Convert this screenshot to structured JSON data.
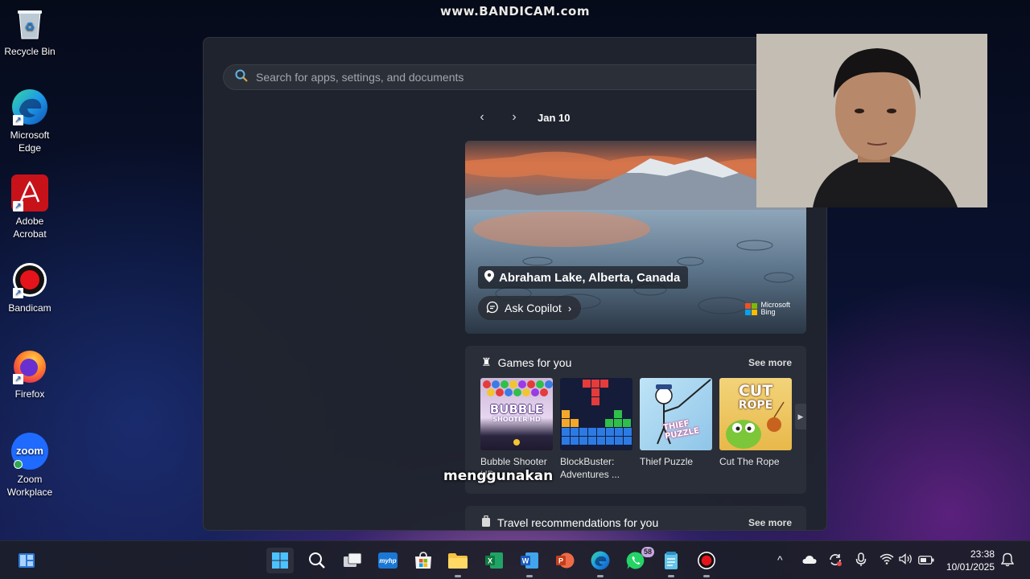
{
  "watermark": "www.BANDICAM.com",
  "desktop_icons": [
    {
      "label": "Recycle Bin"
    },
    {
      "label": "Microsoft Edge"
    },
    {
      "label": "Adobe Acrobat"
    },
    {
      "label": "Bandicam"
    },
    {
      "label": "Firefox"
    },
    {
      "label": "Zoom Workplace",
      "icon_text": "zoom"
    }
  ],
  "search": {
    "placeholder": "Search for apps, settings, and documents"
  },
  "date_nav": {
    "date": "Jan 10"
  },
  "hero": {
    "location": "Abraham Lake, Alberta, Canada",
    "ask_copilot": "Ask Copilot",
    "brand_line1": "Microsoft",
    "brand_line2": "Bing"
  },
  "games_card": {
    "title": "Games for you",
    "see_more": "See more",
    "games": [
      {
        "name": "Bubble Shooter HD",
        "thumb_text_1": "BUBBLE",
        "thumb_text_2": "SHOOTER HD"
      },
      {
        "name": "BlockBuster: Adventures ..."
      },
      {
        "name": "Thief Puzzle",
        "thumb_text": "THIEF PUZZLE"
      },
      {
        "name": "Cut The Rope",
        "thumb_text_1": "CUT",
        "thumb_text_2": "ROPE"
      }
    ]
  },
  "travel_card": {
    "title": "Travel recommendations for you",
    "see_more": "See more"
  },
  "caption": "menggunakan",
  "taskbar": {
    "whatsapp_badge": "58",
    "hp_label": "myhp",
    "time": "23:38",
    "date": "10/01/2025"
  },
  "colors": {
    "accent_blue": "#3b8fe0",
    "panel_bg": "#20242e",
    "card_bg": "#2a2e38"
  }
}
